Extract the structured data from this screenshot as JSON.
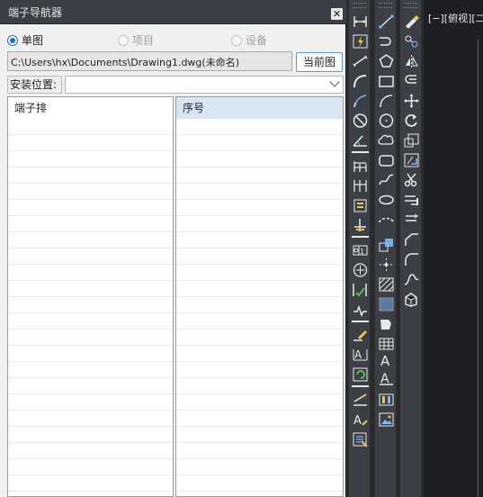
{
  "panel": {
    "title": "端子导航器",
    "close_symbol": "✕",
    "radios": [
      {
        "label": "单图",
        "checked": true,
        "enabled": true
      },
      {
        "label": "项目",
        "checked": false,
        "enabled": false
      },
      {
        "label": "设备",
        "checked": false,
        "enabled": false
      }
    ],
    "path": "C:\\Users\\hx\\Documents\\Drawing1.dwg(未命名)",
    "current_button": "当前图",
    "location_label": "安装位置:",
    "location_value": "",
    "left_list_header": "端子排",
    "right_list_header": "序号"
  },
  "drawing": {
    "viewport_label": "[−][俯视][二"
  },
  "toolbars": {
    "toolbar1": [
      "dimension-linear-icon",
      "lightning-icon",
      "dimension-aligned-icon",
      "arc-dimension-icon",
      "dimension-leader-icon",
      "circle-no-icon",
      "angle-icon",
      "dimension-baseline-icon",
      "dimension-continue-icon",
      "dimension-space-icon",
      "dimension-break-icon",
      "tolerance-icon",
      "center-mark-icon",
      "inspection-icon",
      "jogged-linear-icon",
      "dimension-edit-icon",
      "dimension-text-edit-icon",
      "dimension-update-icon",
      "dimension-style-icon",
      "text-style-icon",
      "dimension-override-icon"
    ],
    "toolbar2": [
      "line-icon",
      "construction-line-icon",
      "polygon-icon",
      "rectangle-icon",
      "arc-icon",
      "circle-icon",
      "revision-cloud-icon",
      "spline-icon",
      "ellipse-icon",
      "ellipse-arc-icon",
      "insert-block-icon",
      "make-block-icon",
      "point-icon",
      "hatch-icon",
      "gradient-icon",
      "region-icon",
      "table-icon",
      "multiline-text-icon",
      "text-icon",
      "attribute-icon",
      "image-icon"
    ],
    "toolbar3": [
      "erase-icon",
      "copy-icon",
      "mirror-icon",
      "offset-icon",
      "move-icon",
      "rotate-icon",
      "scale-icon",
      "stretch-icon",
      "trim-icon",
      "extend-icon",
      "break-icon",
      "chamfer-icon",
      "fillet-icon",
      "blend-icon",
      "explode-icon"
    ]
  },
  "colors": {
    "accent": "#1f6fd1",
    "icon_blue": "#7fb8ff",
    "icon_white": "#e8e8e8",
    "icon_yellow": "#f4c542",
    "icon_green": "#57c14f"
  }
}
